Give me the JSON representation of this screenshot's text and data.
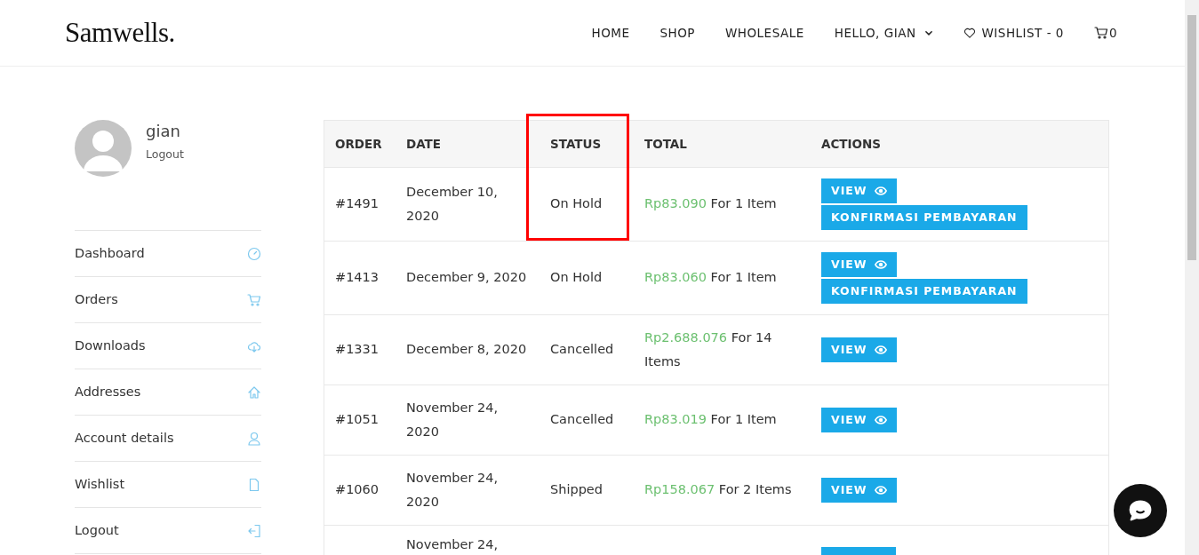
{
  "header": {
    "logo": "Samwells.",
    "nav": [
      {
        "label": "HOME",
        "kind": "link"
      },
      {
        "label": "SHOP",
        "kind": "link"
      },
      {
        "label": "WHOLESALE",
        "kind": "link"
      },
      {
        "label": "HELLO, GIAN",
        "kind": "dropdown"
      },
      {
        "label": "WISHLIST - 0",
        "kind": "wishlist"
      },
      {
        "label": "0",
        "kind": "cart"
      }
    ]
  },
  "profile": {
    "name": "gian",
    "logout": "Logout"
  },
  "sidebar": {
    "items": [
      {
        "label": "Dashboard"
      },
      {
        "label": "Orders"
      },
      {
        "label": "Downloads"
      },
      {
        "label": "Addresses"
      },
      {
        "label": "Account details"
      },
      {
        "label": "Wishlist"
      },
      {
        "label": "Logout"
      }
    ]
  },
  "table": {
    "columns": [
      {
        "label": "ORDER",
        "highlighted": false
      },
      {
        "label": "DATE",
        "highlighted": false
      },
      {
        "label": "STATUS",
        "highlighted": true
      },
      {
        "label": "TOTAL",
        "highlighted": false
      },
      {
        "label": "ACTIONS",
        "highlighted": false
      }
    ],
    "rows": [
      {
        "order": "#1491",
        "date": "December 10, 2020",
        "status": "On Hold",
        "amount": "Rp83.090",
        "items": "For 1 Item",
        "actions": [
          "VIEW",
          "KONFIRMASI PEMBAYARAN"
        ]
      },
      {
        "order": "#1413",
        "date": "December 9, 2020",
        "status": "On Hold",
        "amount": "Rp83.060",
        "items": "For 1 Item",
        "actions": [
          "VIEW",
          "KONFIRMASI PEMBAYARAN"
        ]
      },
      {
        "order": "#1331",
        "date": "December 8, 2020",
        "status": "Cancelled",
        "amount": "Rp2.688.076",
        "items": "For 14 Items",
        "actions": [
          "VIEW"
        ]
      },
      {
        "order": "#1051",
        "date": "November 24, 2020",
        "status": "Cancelled",
        "amount": "Rp83.019",
        "items": "For 1 Item",
        "actions": [
          "VIEW"
        ]
      },
      {
        "order": "#1060",
        "date": "November 24, 2020",
        "status": "Shipped",
        "amount": "Rp158.067",
        "items": "For 2 Items",
        "actions": [
          "VIEW"
        ]
      },
      {
        "date": "November 24,"
      }
    ]
  }
}
